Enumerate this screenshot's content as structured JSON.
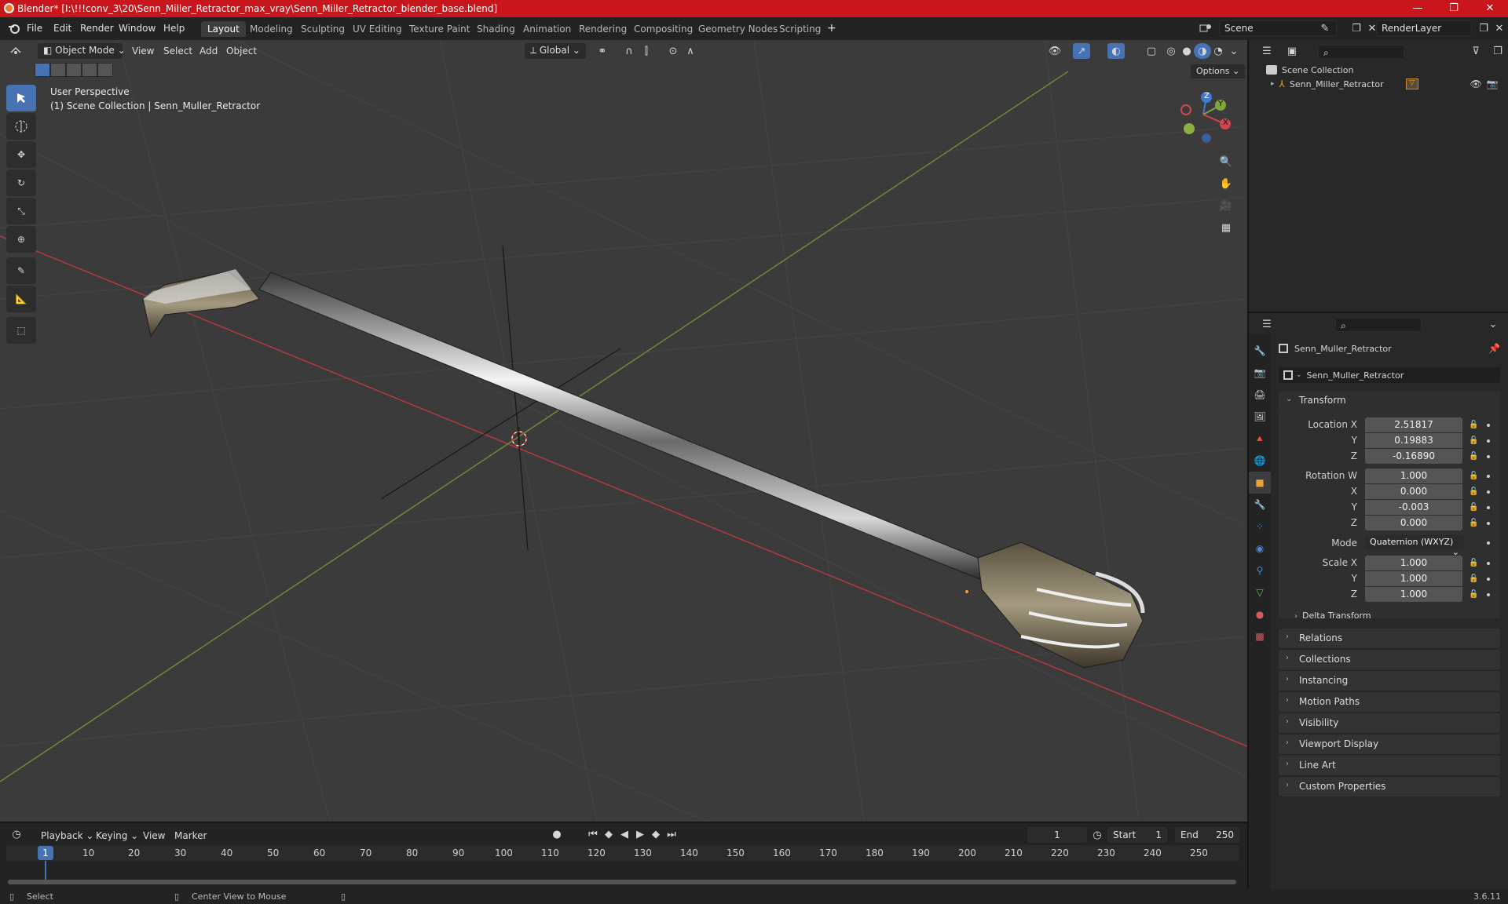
{
  "titlebar": {
    "title": "Blender* [I:\\!!!conv_3\\20\\Senn_Miller_Retractor_max_vray\\Senn_Miller_Retractor_blender_base.blend]",
    "controls": [
      "—",
      "❐",
      "✕"
    ]
  },
  "menu": [
    "File",
    "Edit",
    "Render",
    "Window",
    "Help"
  ],
  "workspaces": [
    {
      "label": "Layout",
      "active": true
    },
    {
      "label": "Modeling"
    },
    {
      "label": "Sculpting"
    },
    {
      "label": "UV Editing"
    },
    {
      "label": "Texture Paint"
    },
    {
      "label": "Shading"
    },
    {
      "label": "Animation"
    },
    {
      "label": "Rendering"
    },
    {
      "label": "Compositing"
    },
    {
      "label": "Geometry Nodes"
    },
    {
      "label": "Scripting"
    }
  ],
  "add_workspace": "+",
  "scene": {
    "name": "Scene",
    "renderlayer": "RenderLayer"
  },
  "viewport": {
    "mode": "Object Mode",
    "menus": [
      "View",
      "Select",
      "Add",
      "Object"
    ],
    "orientation": "Global",
    "options": "Options",
    "info_line1": "User Perspective",
    "info_line2": "(1) Scene Collection | Senn_Muller_Retractor",
    "gizmo": {
      "x": "X",
      "y": "Y",
      "z": "Z"
    }
  },
  "outliner": {
    "root": "Scene Collection",
    "items": [
      {
        "name": "Senn_Miller_Retractor"
      }
    ]
  },
  "properties": {
    "object_name": "Senn_Muller_Retractor",
    "data_name": "Senn_Muller_Retractor",
    "transform_label": "Transform",
    "location": {
      "label": "Location X",
      "x": "2.51817",
      "y": "0.19883",
      "z": "-0.16890"
    },
    "rotation": {
      "label": "Rotation W",
      "w": "1.000",
      "x": "0.000",
      "y": "-0.003",
      "z": "0.000"
    },
    "mode": {
      "label": "Mode",
      "value": "Quaternion (WXYZ)"
    },
    "scale": {
      "label": "Scale X",
      "x": "1.000",
      "y": "1.000",
      "z": "1.000"
    },
    "axis_labels": {
      "y": "Y",
      "z": "Z",
      "x": "X"
    },
    "delta": "Delta Transform",
    "panels": [
      "Relations",
      "Collections",
      "Instancing",
      "Motion Paths",
      "Visibility",
      "Viewport Display",
      "Line Art",
      "Custom Properties"
    ]
  },
  "timeline": {
    "menus": [
      "Playback",
      "Keying",
      "View",
      "Marker"
    ],
    "current_frame": "1",
    "start_label": "Start",
    "start": "1",
    "end_label": "End",
    "end": "250",
    "ticks": [
      "1",
      "10",
      "20",
      "30",
      "40",
      "50",
      "60",
      "70",
      "80",
      "90",
      "100",
      "110",
      "120",
      "130",
      "140",
      "150",
      "160",
      "170",
      "180",
      "190",
      "200",
      "210",
      "220",
      "230",
      "240",
      "250"
    ]
  },
  "status": {
    "select": "Select",
    "center": "Center View to Mouse",
    "version": "3.6.11"
  },
  "colors": {
    "accent": "#4772b3",
    "titlebar": "#c8161c",
    "x_axis": "#d2454f",
    "y_axis": "#7ea63a",
    "z_axis": "#3f7bd6"
  }
}
